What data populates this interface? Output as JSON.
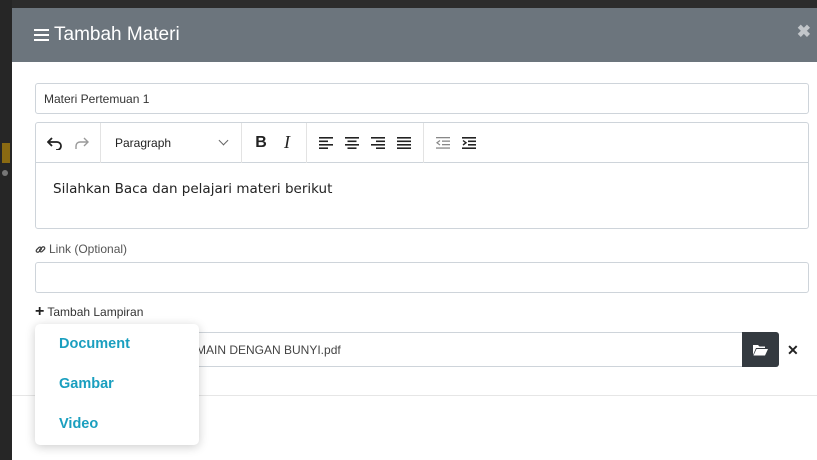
{
  "modal": {
    "title": "Tambah Materi",
    "close_icon": "times-icon"
  },
  "form": {
    "title_value": "Materi Pertemuan 1",
    "editor": {
      "block_format": "Paragraph",
      "content": "Silahkan Baca dan pelajari materi berikut",
      "toolbar_icons": [
        "undo-icon",
        "redo-icon",
        "bold-icon",
        "italic-icon",
        "align-left-icon",
        "align-center-icon",
        "align-right-icon",
        "align-justify-icon",
        "outdent-icon",
        "indent-icon"
      ]
    },
    "link_label": "Link (Optional)",
    "link_value": "",
    "attach_label": "Tambah Lampiran",
    "attachment": {
      "file_name": "MAIN DENGAN BUNYI.pdf"
    }
  },
  "attach_menu": {
    "items": [
      "Document",
      "Gambar",
      "Video"
    ]
  },
  "colors": {
    "header_bg": "#6c757d",
    "menu_text": "#1a9fbf",
    "browse_btn": "#343a40"
  }
}
